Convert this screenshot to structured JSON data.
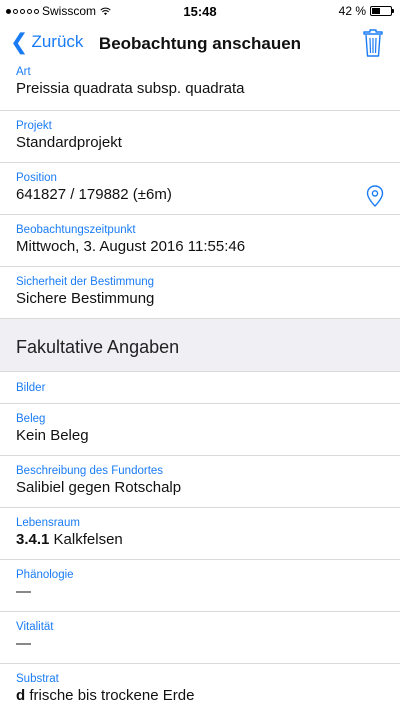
{
  "status": {
    "carrier": "Swisscom",
    "time": "15:48",
    "battery": "42 %",
    "battery_level": 0.42,
    "signal_dots_filled": 1,
    "signal_dots_total": 5
  },
  "nav": {
    "back_label": "Zurück",
    "title": "Beobachtung anschauen",
    "icons": {
      "back": "chevron-left-icon",
      "delete": "trash-icon"
    }
  },
  "fields": [
    {
      "label": "Art",
      "value": "Preissia quadrata subsp. quadrata"
    },
    {
      "label": "Projekt",
      "value": "Standardprojekt"
    },
    {
      "label": "Position",
      "value": "641827 / 179882 (±6m)",
      "icon": "location-pin-icon"
    },
    {
      "label": "Beobachtungszeitpunkt",
      "value": "Mittwoch, 3. August 2016 11:55:46"
    },
    {
      "label": "Sicherheit der Bestimmung",
      "value": "Sichere Bestimmung"
    }
  ],
  "section_title": "Fakultative Angaben",
  "optional_fields": [
    {
      "label": "Bilder",
      "value": ""
    },
    {
      "label": "Beleg",
      "value": "Kein Beleg"
    },
    {
      "label": "Beschreibung des Fundortes",
      "value": "Salibiel gegen Rotschalp"
    },
    {
      "label": "Lebensraum",
      "code": "3.4.1",
      "value": "Kalkfelsen"
    },
    {
      "label": "Phänologie",
      "value": "—"
    },
    {
      "label": "Vitalität",
      "value": "—"
    },
    {
      "label": "Substrat",
      "code": "d",
      "value": "frische bis trockene Erde"
    }
  ],
  "colors": {
    "accent": "#1a7cf5",
    "section_bg": "#efeff4",
    "separator": "#d9d9d9"
  }
}
